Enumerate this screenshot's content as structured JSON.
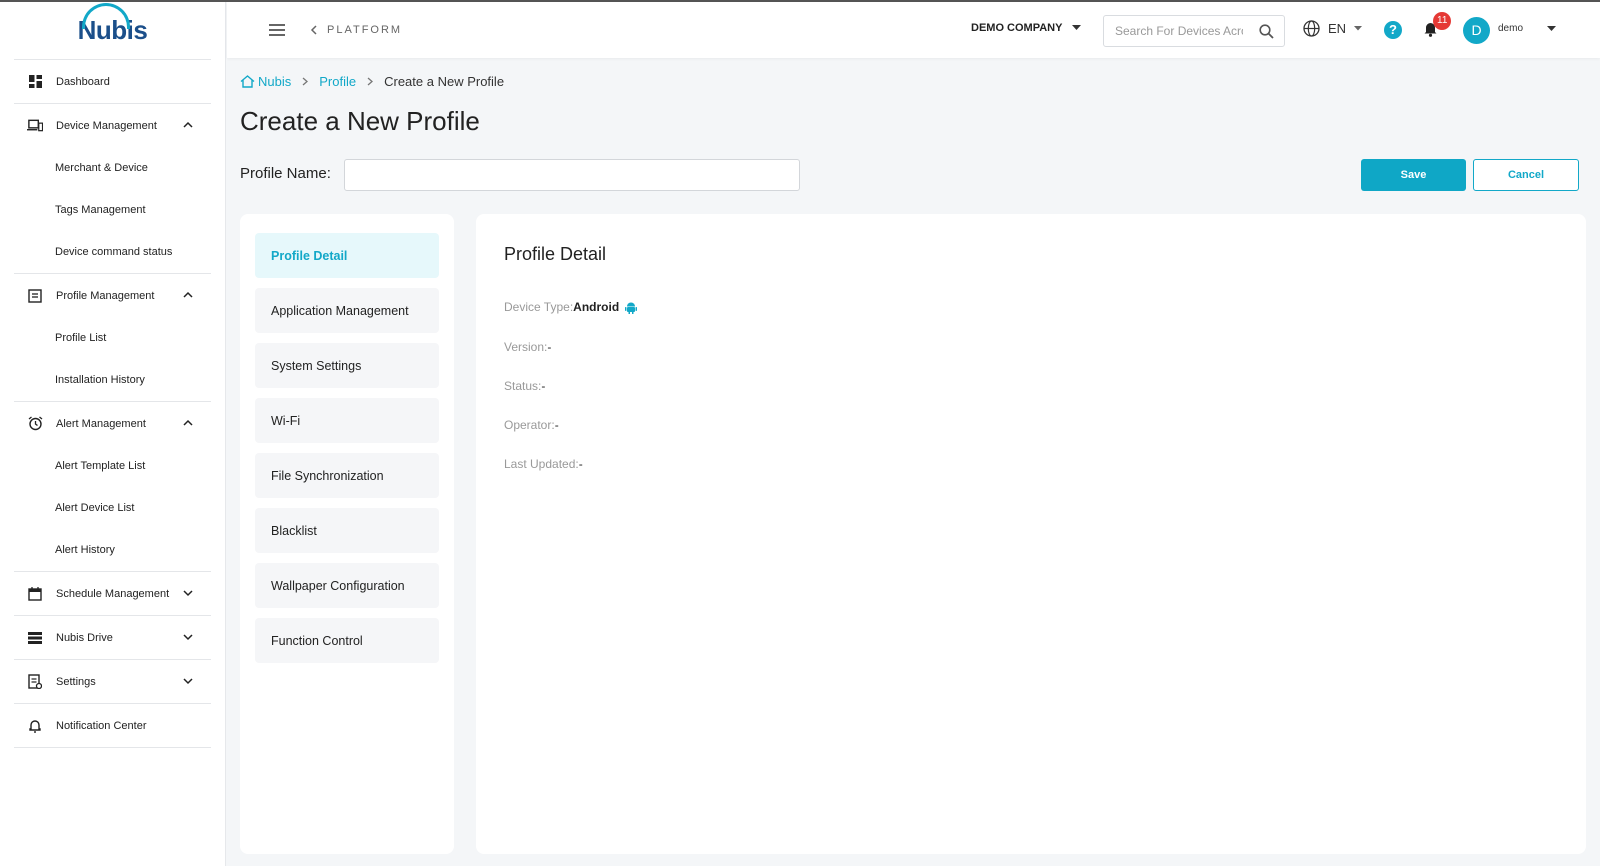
{
  "brand": {
    "logo": "Nubis",
    "accent": "#12a8c8"
  },
  "sidebar": {
    "items": [
      {
        "label": "Dashboard",
        "icon": "dashboard-icon"
      },
      {
        "label": "Device Management",
        "icon": "devices-icon",
        "expanded": true,
        "children": [
          "Merchant & Device",
          "Tags Management",
          "Device command status"
        ]
      },
      {
        "label": "Profile Management",
        "icon": "profile-icon",
        "expanded": true,
        "children": [
          "Profile List",
          "Installation History"
        ]
      },
      {
        "label": "Alert Management",
        "icon": "alarm-icon",
        "expanded": true,
        "children": [
          "Alert Template List",
          "Alert Device List",
          "Alert History"
        ]
      },
      {
        "label": "Schedule Management",
        "icon": "calendar-icon",
        "expanded": false
      },
      {
        "label": "Nubis Drive",
        "icon": "drive-icon",
        "expanded": false
      },
      {
        "label": "Settings",
        "icon": "settings-icon",
        "expanded": false
      },
      {
        "label": "Notification Center",
        "icon": "bell-icon"
      }
    ]
  },
  "topbar": {
    "platform": "PLATFORM",
    "company": "DEMO COMPANY",
    "search_placeholder": "Search For Devices Across",
    "language": "EN",
    "help": "?",
    "notification_count": "11",
    "avatar_initial": "D",
    "username": "demo"
  },
  "breadcrumb": {
    "home": "Nubis",
    "parent": "Profile",
    "current": "Create a New Profile"
  },
  "page": {
    "title": "Create a New Profile",
    "profile_name_label": "Profile Name:",
    "profile_name_value": "",
    "save_label": "Save",
    "cancel_label": "Cancel"
  },
  "profile_menu": [
    {
      "label": "Profile Detail",
      "active": true
    },
    {
      "label": "Application Management"
    },
    {
      "label": "System Settings"
    },
    {
      "label": "Wi-Fi"
    },
    {
      "label": "File Synchronization"
    },
    {
      "label": "Blacklist"
    },
    {
      "label": "Wallpaper Configuration"
    },
    {
      "label": "Function Control"
    }
  ],
  "detail": {
    "title": "Profile Detail",
    "device_type_label": "Device Type:",
    "device_type_value": "Android",
    "version_label": "Version:",
    "version_value": "-",
    "status_label": "Status:",
    "status_value": "-",
    "operator_label": "Operator:",
    "operator_value": "-",
    "last_updated_label": "Last Updated:",
    "last_updated_value": "-"
  }
}
